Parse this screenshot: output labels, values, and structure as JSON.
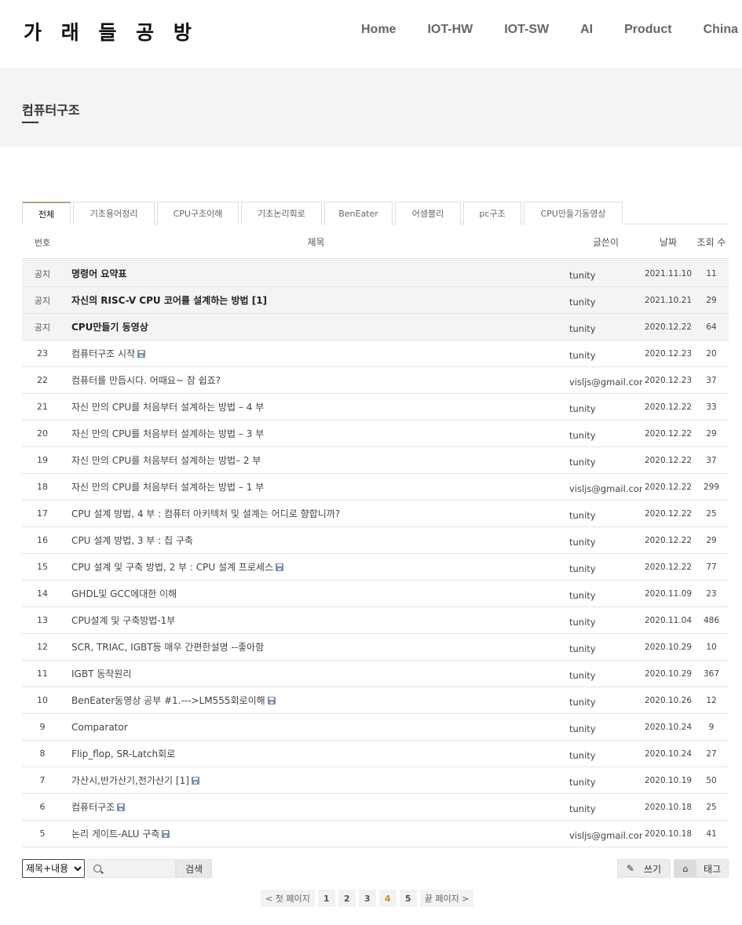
{
  "header": {
    "logo": "가 래 들 공 방",
    "nav": [
      "Home",
      "IOT-HW",
      "IOT-SW",
      "AI",
      "Product",
      "China Pro"
    ]
  },
  "page": {
    "title": "컴퓨터구조"
  },
  "tabs": [
    "전체",
    "기초용어정리",
    "CPU구조이해",
    "기초논리회로",
    "BenEater",
    "어셈블리",
    "pc구조",
    "CPU만들기동영상"
  ],
  "table": {
    "headers": {
      "no": "번호",
      "title": "제목",
      "author": "글쓴이",
      "date": "날짜",
      "views": "조회 수"
    },
    "rows": [
      {
        "no": "공지",
        "title": "명령어 요약표",
        "author": "tunity",
        "date": "2021.11.10",
        "views": "11",
        "notice": true,
        "file": false
      },
      {
        "no": "공지",
        "title": "자신의 RISC-V CPU 코어를 설계하는 방법 [1]",
        "author": "tunity",
        "date": "2021.10.21",
        "views": "29",
        "notice": true,
        "file": false
      },
      {
        "no": "공지",
        "title": "CPU만들기 동영상",
        "author": "tunity",
        "date": "2020.12.22",
        "views": "64",
        "notice": true,
        "file": false
      },
      {
        "no": "23",
        "title": "컴퓨터구조 시작",
        "author": "tunity",
        "date": "2020.12.23",
        "views": "20",
        "notice": false,
        "file": true
      },
      {
        "no": "22",
        "title": "컴퓨터를 만듭시다. 어때요~ 참 쉽죠?",
        "author": "visljs@gmail.com",
        "date": "2020.12.23",
        "views": "37",
        "notice": false,
        "file": false
      },
      {
        "no": "21",
        "title": "자신 만의 CPU를 처음부터 설계하는 방법 – 4 부",
        "author": "tunity",
        "date": "2020.12.22",
        "views": "33",
        "notice": false,
        "file": false
      },
      {
        "no": "20",
        "title": "자신 만의 CPU를 처음부터 설계하는 방법 – 3 부",
        "author": "tunity",
        "date": "2020.12.22",
        "views": "29",
        "notice": false,
        "file": false
      },
      {
        "no": "19",
        "title": "자신 만의 CPU를 처음부터 설계하는 방법– 2 부",
        "author": "tunity",
        "date": "2020.12.22",
        "views": "37",
        "notice": false,
        "file": false
      },
      {
        "no": "18",
        "title": "자신 만의 CPU를 처음부터 설계하는 방법 – 1 부",
        "author": "visljs@gmail.com",
        "date": "2020.12.22",
        "views": "299",
        "notice": false,
        "file": false
      },
      {
        "no": "17",
        "title": "CPU 설계 방법, 4 부 : 컴퓨터 아키텍처 및 설계는 어디로 향합니까?",
        "author": "tunity",
        "date": "2020.12.22",
        "views": "25",
        "notice": false,
        "file": false
      },
      {
        "no": "16",
        "title": "CPU 설계 방법, 3 부 : 칩 구축",
        "author": "tunity",
        "date": "2020.12.22",
        "views": "29",
        "notice": false,
        "file": false
      },
      {
        "no": "15",
        "title": "CPU 설계 및 구축 방법, 2 부 : CPU 설계 프로세스",
        "author": "tunity",
        "date": "2020.12.22",
        "views": "77",
        "notice": false,
        "file": true
      },
      {
        "no": "14",
        "title": "GHDL및 GCC에대한 이해",
        "author": "tunity",
        "date": "2020.11.09",
        "views": "23",
        "notice": false,
        "file": false
      },
      {
        "no": "13",
        "title": "CPU설계 및 구축방법-1부",
        "author": "tunity",
        "date": "2020.11.04",
        "views": "486",
        "notice": false,
        "file": false
      },
      {
        "no": "12",
        "title": "SCR, TRIAC, IGBT등 매우 간편한설명 --좋아함",
        "author": "tunity",
        "date": "2020.10.29",
        "views": "10",
        "notice": false,
        "file": false
      },
      {
        "no": "11",
        "title": "IGBT 동작원리",
        "author": "tunity",
        "date": "2020.10.29",
        "views": "367",
        "notice": false,
        "file": false
      },
      {
        "no": "10",
        "title": "BenEater동영상 공부 #1.--->LM555회로이해",
        "author": "tunity",
        "date": "2020.10.26",
        "views": "12",
        "notice": false,
        "file": true
      },
      {
        "no": "9",
        "title": "Comparator",
        "author": "tunity",
        "date": "2020.10.24",
        "views": "9",
        "notice": false,
        "file": false
      },
      {
        "no": "8",
        "title": "Flip_flop, SR-Latch회로",
        "author": "tunity",
        "date": "2020.10.24",
        "views": "27",
        "notice": false,
        "file": false
      },
      {
        "no": "7",
        "title": "가산시,반가산기,전가산기 [1]",
        "author": "tunity",
        "date": "2020.10.19",
        "views": "50",
        "notice": false,
        "file": true
      },
      {
        "no": "6",
        "title": "컴퓨터구조",
        "author": "tunity",
        "date": "2020.10.18",
        "views": "25",
        "notice": false,
        "file": true
      },
      {
        "no": "5",
        "title": "논리 게이트-ALU 구축",
        "author": "visljs@gmail.com",
        "date": "2020.10.18",
        "views": "41",
        "notice": false,
        "file": true
      }
    ]
  },
  "search": {
    "selected": "제목+내용",
    "placeholder": "",
    "button": "검색"
  },
  "actions": {
    "write": "쓰기",
    "tag": "태그"
  },
  "pagination": {
    "first": "< 첫 페이지",
    "pages": [
      "1",
      "2",
      "3",
      "4",
      "5"
    ],
    "current": "4",
    "last": "끝 페이지 >"
  }
}
